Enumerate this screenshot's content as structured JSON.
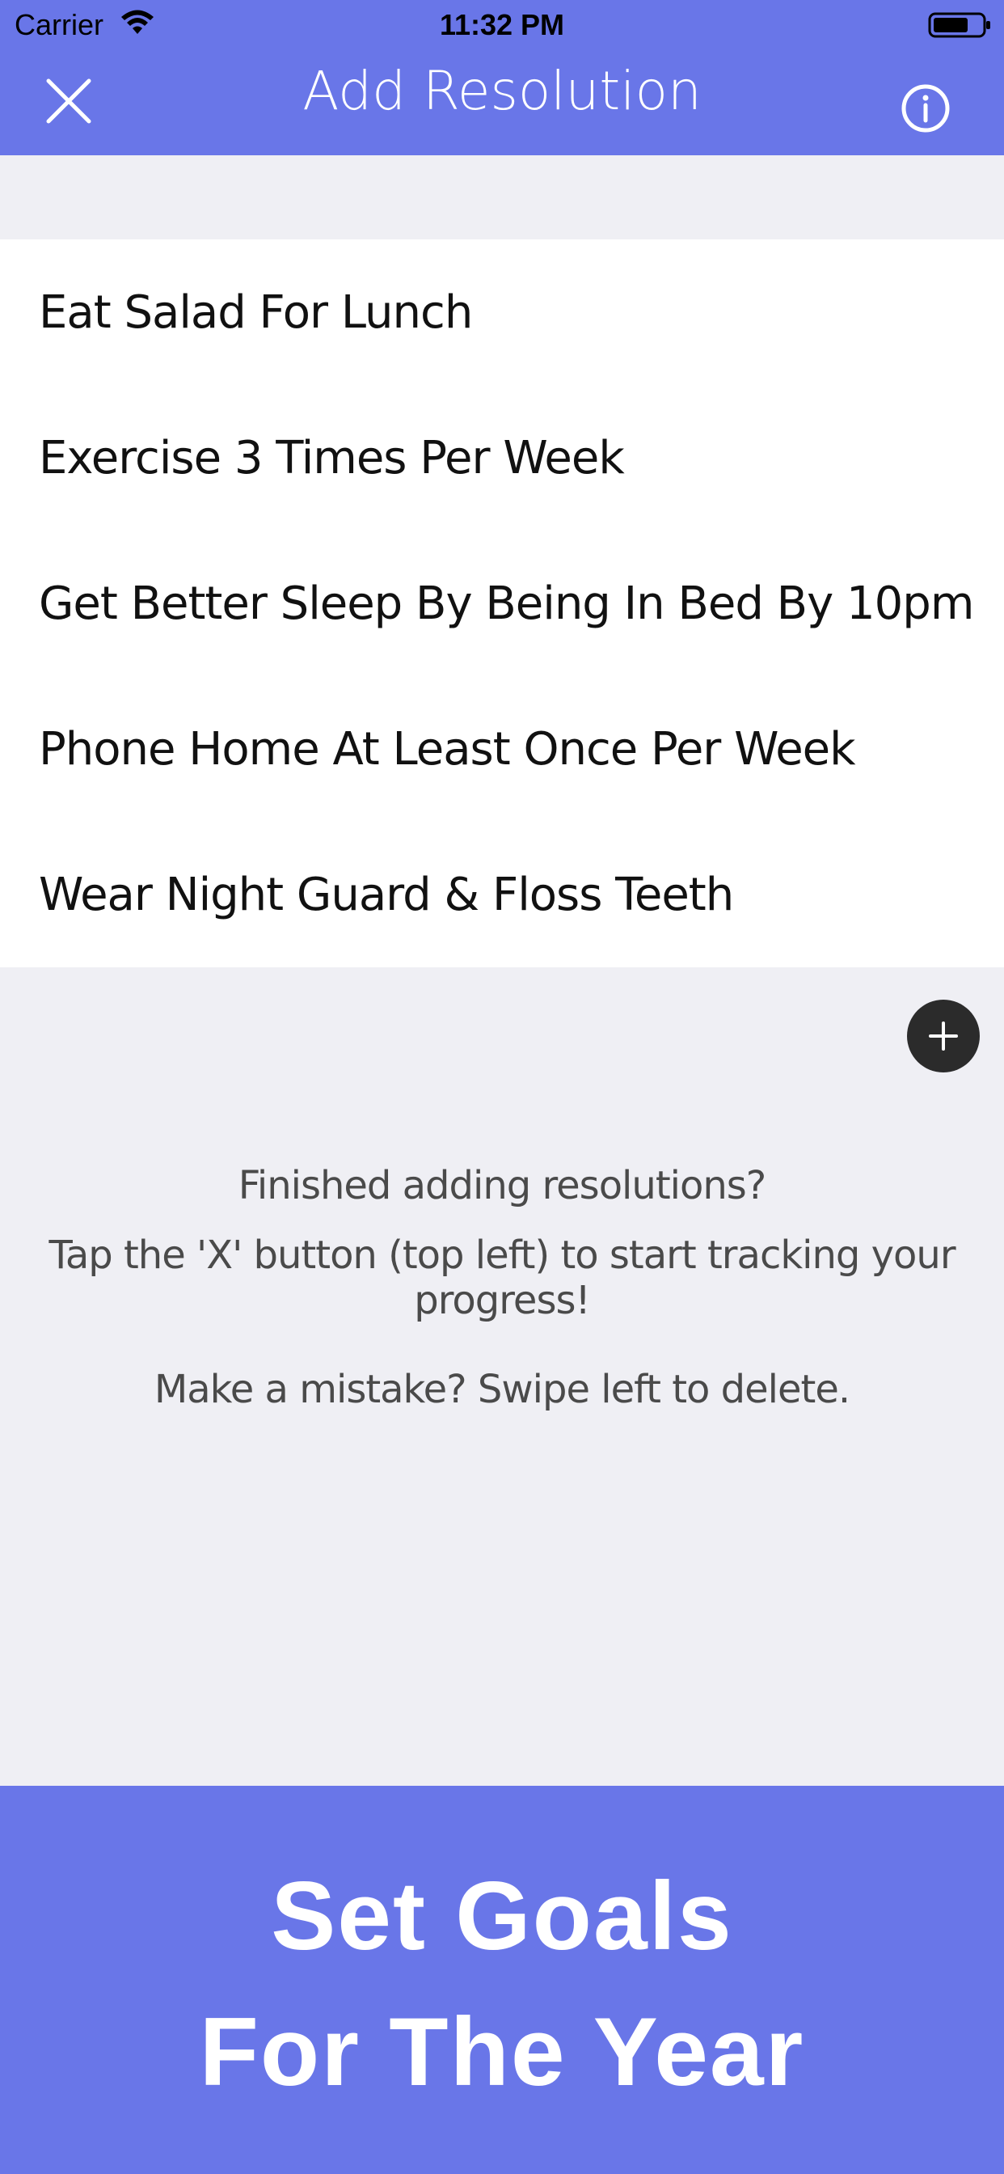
{
  "status_bar": {
    "carrier": "Carrier",
    "time": "11:32 PM"
  },
  "nav": {
    "title": "Add Resolution",
    "close_icon": "close-icon",
    "info_icon": "info-icon"
  },
  "resolutions": [
    "Eat Salad For Lunch",
    "Exercise 3 Times Per Week",
    "Get Better Sleep By Being In Bed By 10pm",
    "Phone Home At Least Once Per Week",
    "Wear Night Guard & Floss Teeth"
  ],
  "add_button": {
    "icon": "plus-icon"
  },
  "help": {
    "line1": "Finished adding resolutions?",
    "line2": "Tap the 'X' button (top left) to start tracking your progress!",
    "line3": "Make a mistake? Swipe left to delete."
  },
  "banner": {
    "line1": "Set Goals",
    "line2": "For The Year"
  },
  "colors": {
    "accent": "#6976e8",
    "background": "#efeff4",
    "list_background": "#ffffff",
    "add_button": "#2b2b2b"
  }
}
